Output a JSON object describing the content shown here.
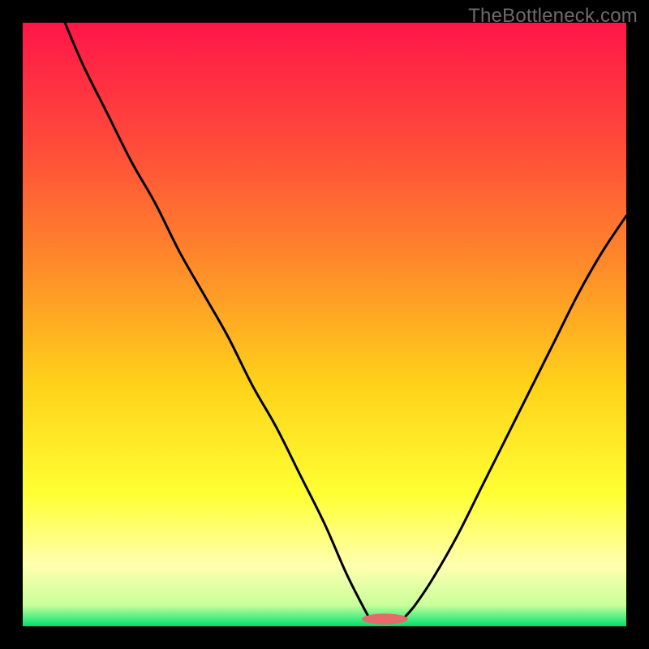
{
  "watermark": {
    "text": "TheBottleneck.com"
  },
  "chart_data": {
    "type": "line",
    "title": "",
    "xlabel": "",
    "ylabel": "",
    "xlim": [
      0,
      100
    ],
    "ylim": [
      0,
      100
    ],
    "grid": false,
    "legend": false,
    "notes": "Bottleneck-style V-curve on a vertical rainbow gradient. Y-values are percentage of plot height from bottom (0 = bottom, 100 = top). X-values are percentage of plot width from left.",
    "background_gradient_stops": [
      {
        "offset": 0.0,
        "color": "#ff1649"
      },
      {
        "offset": 0.2,
        "color": "#ff4a3a"
      },
      {
        "offset": 0.4,
        "color": "#ff8a2a"
      },
      {
        "offset": 0.6,
        "color": "#ffd21a"
      },
      {
        "offset": 0.78,
        "color": "#ffff33"
      },
      {
        "offset": 0.9,
        "color": "#ffffb0"
      },
      {
        "offset": 0.965,
        "color": "#c9ff9a"
      },
      {
        "offset": 1.0,
        "color": "#00e070"
      }
    ],
    "series": [
      {
        "name": "left-arm",
        "x": [
          7,
          10,
          14,
          18,
          22,
          26,
          30,
          34,
          38,
          42,
          46,
          50,
          53.5,
          56,
          57.5
        ],
        "y": [
          100,
          93,
          85,
          77,
          70,
          62,
          55,
          48,
          40,
          33,
          25,
          17,
          9,
          4,
          1.2
        ]
      },
      {
        "name": "right-arm",
        "x": [
          63,
          65,
          68,
          72,
          76,
          80,
          84,
          88,
          92,
          96,
          100
        ],
        "y": [
          1.2,
          3.5,
          8,
          15,
          23,
          31,
          39,
          47,
          55,
          62,
          68
        ]
      }
    ],
    "marker": {
      "name": "optimal-marker",
      "cx": 60,
      "cy": 1.2,
      "rx": 3.8,
      "ry": 0.9,
      "fill": "#e76a6a"
    },
    "frame": {
      "stroke": "#000000",
      "stroke_width": 28
    },
    "curve_style": {
      "stroke": "#000000",
      "stroke_width": 3
    }
  }
}
